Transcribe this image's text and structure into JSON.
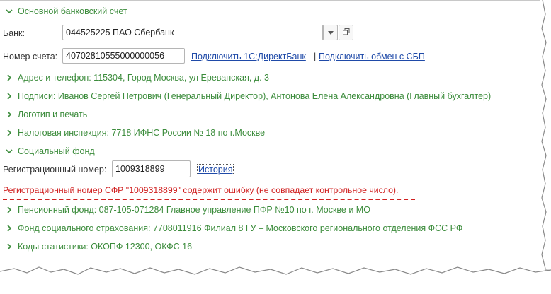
{
  "sections": {
    "bank_account": {
      "title": "Основной банковский счет",
      "expanded": true
    },
    "address": {
      "title": "Адрес и телефон: 115304, Город Москва, ул Ереванская, д. 3",
      "expanded": false
    },
    "signatures": {
      "title": "Подписи: Иванов Сергей Петрович (Генеральный Директор), Антонова Елена Александровна (Главный бухгалтер)",
      "expanded": false
    },
    "logo": {
      "title": "Логотип и печать",
      "expanded": false
    },
    "tax": {
      "title": "Налоговая инспекция: 7718 ИФНС России № 18 по г.Москве",
      "expanded": false
    },
    "social_fund": {
      "title": "Социальный фонд",
      "expanded": true
    },
    "pension": {
      "title": "Пенсионный фонд: 087-105-071284 Главное управление ПФР №10 по г. Москве и МО",
      "expanded": false
    },
    "fss": {
      "title": "Фонд социального страхования: 7708011916 Филиал 8 ГУ – Московского регионального отделения ФСС РФ",
      "expanded": false
    },
    "stats": {
      "title": "Коды статистики: ОКОПФ 12300, ОКФС 16",
      "expanded": false
    }
  },
  "bank": {
    "label": "Банк:",
    "value": "044525225 ПАО Сбербанк",
    "dropdown_icon": "triangle-down-icon",
    "open_icon": "open-form-icon"
  },
  "account": {
    "label": "Номер счета:",
    "value": "40702810555000000056",
    "link_directbank": "Подключить 1С:ДиректБанк",
    "separator": "|",
    "link_sbp": "Подключить обмен с СБП"
  },
  "registration": {
    "label": "Регистрационный номер:",
    "value": "1009318899",
    "history_link": "История"
  },
  "error_message": "Регистрационный номер СФР \"1009318899\" содержит ошибку (не совпадает контрольное число).",
  "colors": {
    "section_text": "#3c8c3c",
    "link": "#1f4aa8",
    "error": "#d02020"
  }
}
